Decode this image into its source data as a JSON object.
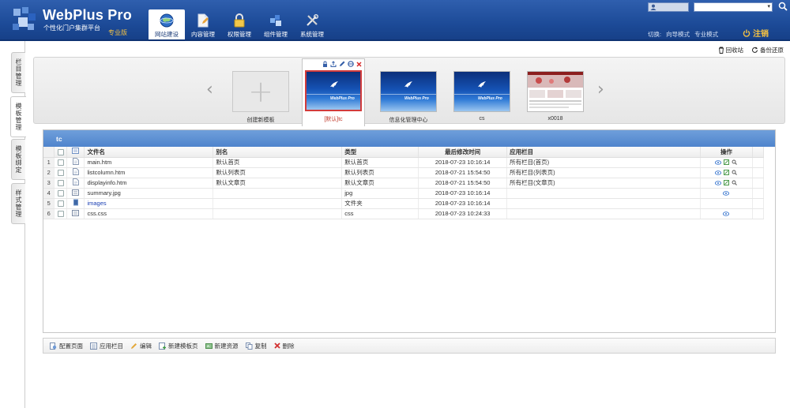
{
  "header": {
    "brand": "WebPlus Pro",
    "tagline": "个性化门户集群平台",
    "edition": "专业版",
    "nav": [
      {
        "label": "网站建设",
        "icon": "globe-icon",
        "active": true
      },
      {
        "label": "内容管理",
        "icon": "document-icon",
        "active": false
      },
      {
        "label": "权限管理",
        "icon": "lock-icon",
        "active": false
      },
      {
        "label": "组件管理",
        "icon": "component-icon",
        "active": false
      },
      {
        "label": "系统管理",
        "icon": "tools-icon",
        "active": false
      }
    ],
    "switch_label": "切换:",
    "guide_mode": "向导模式",
    "pro_mode": "专业模式",
    "logout": "注销"
  },
  "sidebar": {
    "tabs": [
      {
        "label": "栏目管理",
        "active": false
      },
      {
        "label": "模板管理",
        "active": true
      },
      {
        "label": "模板绑定",
        "active": false
      },
      {
        "label": "样式管理",
        "active": false
      }
    ]
  },
  "top_toolbar": {
    "recycle": "回收站",
    "backup": "备份还原"
  },
  "templates": [
    {
      "caption": "创建新模板",
      "kind": "add"
    },
    {
      "caption": "[默认]tc",
      "kind": "blue",
      "selected": true
    },
    {
      "caption": "信息化管理中心",
      "kind": "blue"
    },
    {
      "caption": "cs",
      "kind": "blue"
    },
    {
      "caption": "x0018",
      "kind": "shop"
    }
  ],
  "thumb_brand": "WebPlus Pro",
  "panel": {
    "title": "tc",
    "columns": {
      "name": "文件名",
      "alias": "别名",
      "type": "类型",
      "modified": "最后修改时间",
      "applied": "应用栏目",
      "ops": "操作"
    },
    "rows": [
      {
        "n": "1",
        "name": "main.htm",
        "alias": "默认首页",
        "type": "默认首页",
        "modified": "2018-07-23 10:16:14",
        "applied": "所有栏目(首页)",
        "icon": "page",
        "ops": "full"
      },
      {
        "n": "2",
        "name": "listcolumn.htm",
        "alias": "默认列表页",
        "type": "默认列表页",
        "modified": "2018-07-21 15:54:50",
        "applied": "所有栏目(列表页)",
        "icon": "page",
        "ops": "full"
      },
      {
        "n": "3",
        "name": "displayinfo.htm",
        "alias": "默认文章页",
        "type": "默认文章页",
        "modified": "2018-07-21 15:54:50",
        "applied": "所有栏目(文章页)",
        "icon": "page",
        "ops": "full"
      },
      {
        "n": "4",
        "name": "summary.jpg",
        "alias": "",
        "type": "jpg",
        "modified": "2018-07-23 10:16:14",
        "applied": "",
        "icon": "file",
        "ops": "view"
      },
      {
        "n": "5",
        "name": "images",
        "alias": "",
        "type": "文件夹",
        "modified": "2018-07-23 10:16:14",
        "applied": "",
        "icon": "folder",
        "ops": "none"
      },
      {
        "n": "6",
        "name": "css.css",
        "alias": "",
        "type": "css",
        "modified": "2018-07-23 10:24:33",
        "applied": "",
        "icon": "file",
        "ops": "view"
      }
    ]
  },
  "bottom_toolbar": [
    {
      "label": "配置页面",
      "icon": "config-page-icon"
    },
    {
      "label": "应用栏目",
      "icon": "apply-column-icon"
    },
    {
      "label": "编辑",
      "icon": "pencil-icon"
    },
    {
      "label": "新建模板页",
      "icon": "new-template-icon"
    },
    {
      "label": "新建资源",
      "icon": "new-resource-icon"
    },
    {
      "label": "复制",
      "icon": "copy-icon"
    },
    {
      "label": "删除",
      "icon": "delete-icon"
    }
  ]
}
